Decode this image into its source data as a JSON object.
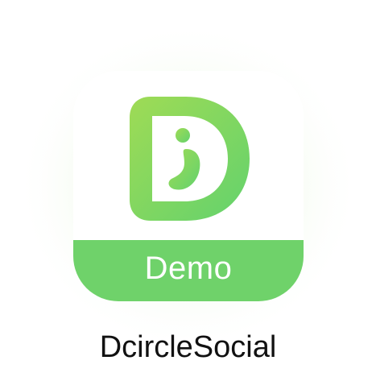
{
  "app": {
    "name": "DcircleSocial",
    "badge_label": "Demo",
    "logo_icon": "letter-d-logo-icon"
  },
  "colors": {
    "background": "#ffffff",
    "glow": "#e8f6df",
    "brand_green_light": "#9ad956",
    "brand_green": "#6fd26a",
    "badge_band": "#6fd26a",
    "label_text": "#ffffff",
    "app_name_text": "#111111"
  }
}
